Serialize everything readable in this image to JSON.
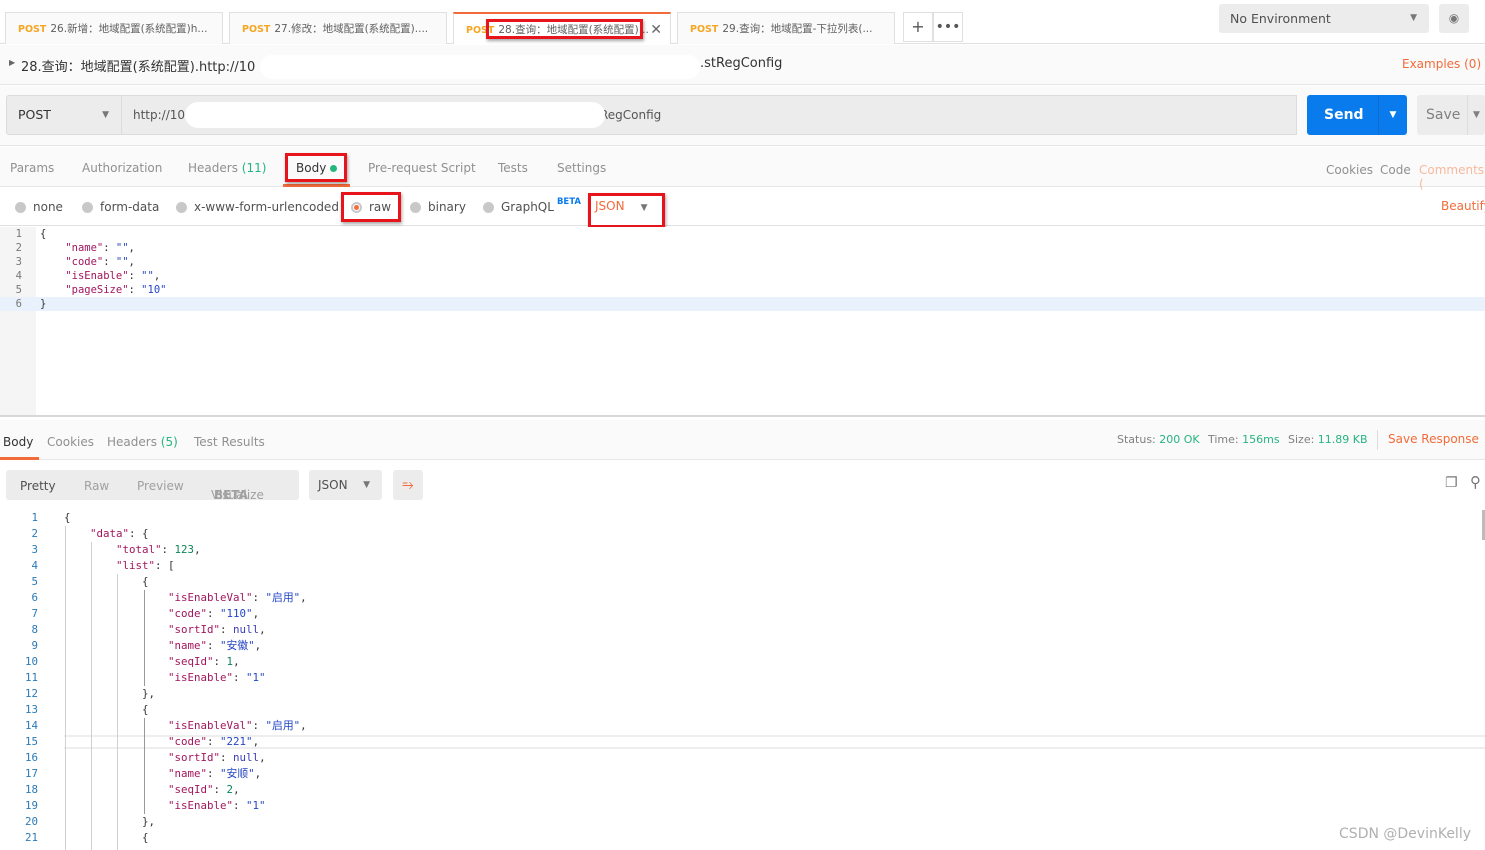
{
  "tabs": [
    {
      "method": "POST",
      "label": "26.新增：地域配置(系统配置)h..."
    },
    {
      "method": "POST",
      "label": "27.修改：地域配置(系统配置)...."
    },
    {
      "method": "POST",
      "label": "28.查询：地域配置(系统配置)...",
      "active": true
    },
    {
      "method": "POST",
      "label": "29.查询：地域配置-下拉列表(..."
    }
  ],
  "environment": "No Environment",
  "request": {
    "title_prefix": "28.查询：地域配置(系统配置).http://10",
    "title_suffix": ".stRegConfig",
    "examples": "Examples (0)",
    "method": "POST",
    "url_prefix": "http://10",
    "url_suffix": "RegConfig",
    "send": "Send",
    "save": "Save",
    "tabs": {
      "params": "Params",
      "authorization": "Authorization",
      "headers": "Headers",
      "headers_count": "(11)",
      "body": "Body",
      "prerequest": "Pre-request Script",
      "tests": "Tests",
      "settings": "Settings"
    },
    "links": {
      "cookies": "Cookies",
      "code": "Code",
      "comments": "Comments ("
    },
    "body_modes": [
      "none",
      "form-data",
      "x-www-form-urlencoded",
      "raw",
      "binary",
      "GraphQL"
    ],
    "selected_mode": "raw",
    "beta": "BETA",
    "format": "JSON",
    "beautify": "Beautify",
    "body_lines": [
      [
        [
          "p",
          "{"
        ]
      ],
      [
        [
          "p",
          "    "
        ],
        [
          "k",
          "\"name\""
        ],
        [
          "p",
          ": "
        ],
        [
          "s",
          "\"\""
        ],
        [
          "p",
          ","
        ]
      ],
      [
        [
          "p",
          "    "
        ],
        [
          "k",
          "\"code\""
        ],
        [
          "p",
          ": "
        ],
        [
          "s",
          "\"\""
        ],
        [
          "p",
          ","
        ]
      ],
      [
        [
          "p",
          "    "
        ],
        [
          "k",
          "\"isEnable\""
        ],
        [
          "p",
          ": "
        ],
        [
          "s",
          "\"\""
        ],
        [
          "p",
          ","
        ]
      ],
      [
        [
          "p",
          "    "
        ],
        [
          "k",
          "\"pageSize\""
        ],
        [
          "p",
          ": "
        ],
        [
          "s",
          "\"10\""
        ]
      ],
      [
        [
          "p",
          "}"
        ]
      ]
    ]
  },
  "response": {
    "tabs": {
      "body": "Body",
      "cookies": "Cookies",
      "headers": "Headers",
      "headers_count": "(5)",
      "test_results": "Test Results"
    },
    "status_label": "Status:",
    "status": "200 OK",
    "time_label": "Time:",
    "time": "156ms",
    "size_label": "Size:",
    "size": "11.89 KB",
    "save_response": "Save Response",
    "views": [
      "Pretty",
      "Raw",
      "Preview",
      "Visualize"
    ],
    "beta": "BETA",
    "format": "JSON",
    "lines": [
      [
        [
          "p",
          "{"
        ]
      ],
      [
        [
          "p",
          "    "
        ],
        [
          "k",
          "\"data\""
        ],
        [
          "p",
          ": {"
        ]
      ],
      [
        [
          "p",
          "        "
        ],
        [
          "k",
          "\"total\""
        ],
        [
          "p",
          ": "
        ],
        [
          "n",
          "123"
        ],
        [
          "p",
          ","
        ]
      ],
      [
        [
          "p",
          "        "
        ],
        [
          "k",
          "\"list\""
        ],
        [
          "p",
          ": ["
        ]
      ],
      [
        [
          "p",
          "            {"
        ]
      ],
      [
        [
          "p",
          "                "
        ],
        [
          "k",
          "\"isEnableVal\""
        ],
        [
          "p",
          ": "
        ],
        [
          "s",
          "\"启用\""
        ],
        [
          "p",
          ","
        ]
      ],
      [
        [
          "p",
          "                "
        ],
        [
          "k",
          "\"code\""
        ],
        [
          "p",
          ": "
        ],
        [
          "s",
          "\"110\""
        ],
        [
          "p",
          ","
        ]
      ],
      [
        [
          "p",
          "                "
        ],
        [
          "k",
          "\"sortId\""
        ],
        [
          "p",
          ": "
        ],
        [
          "nl",
          "null"
        ],
        [
          "p",
          ","
        ]
      ],
      [
        [
          "p",
          "                "
        ],
        [
          "k",
          "\"name\""
        ],
        [
          "p",
          ": "
        ],
        [
          "s",
          "\"安徽\""
        ],
        [
          "p",
          ","
        ]
      ],
      [
        [
          "p",
          "                "
        ],
        [
          "k",
          "\"seqId\""
        ],
        [
          "p",
          ": "
        ],
        [
          "n",
          "1"
        ],
        [
          "p",
          ","
        ]
      ],
      [
        [
          "p",
          "                "
        ],
        [
          "k",
          "\"isEnable\""
        ],
        [
          "p",
          ": "
        ],
        [
          "s",
          "\"1\""
        ]
      ],
      [
        [
          "p",
          "            },"
        ]
      ],
      [
        [
          "p",
          "            {"
        ]
      ],
      [
        [
          "p",
          "                "
        ],
        [
          "k",
          "\"isEnableVal\""
        ],
        [
          "p",
          ": "
        ],
        [
          "s",
          "\"启用\""
        ],
        [
          "p",
          ","
        ]
      ],
      [
        [
          "p",
          "                "
        ],
        [
          "k",
          "\"code\""
        ],
        [
          "p",
          ": "
        ],
        [
          "s",
          "\"221\""
        ],
        [
          "p",
          ","
        ]
      ],
      [
        [
          "p",
          "                "
        ],
        [
          "k",
          "\"sortId\""
        ],
        [
          "p",
          ": "
        ],
        [
          "nl",
          "null"
        ],
        [
          "p",
          ","
        ]
      ],
      [
        [
          "p",
          "                "
        ],
        [
          "k",
          "\"name\""
        ],
        [
          "p",
          ": "
        ],
        [
          "s",
          "\"安顺\""
        ],
        [
          "p",
          ","
        ]
      ],
      [
        [
          "p",
          "                "
        ],
        [
          "k",
          "\"seqId\""
        ],
        [
          "p",
          ": "
        ],
        [
          "n",
          "2"
        ],
        [
          "p",
          ","
        ]
      ],
      [
        [
          "p",
          "                "
        ],
        [
          "k",
          "\"isEnable\""
        ],
        [
          "p",
          ": "
        ],
        [
          "s",
          "\"1\""
        ]
      ],
      [
        [
          "p",
          "            },"
        ]
      ],
      [
        [
          "p",
          "            {"
        ]
      ]
    ]
  },
  "watermark": "CSDN @DevinKelly",
  "colors": {
    "accent": "#f26b3a",
    "send": "#097bed",
    "success": "#26b47f",
    "highlight": "#e8141c"
  }
}
